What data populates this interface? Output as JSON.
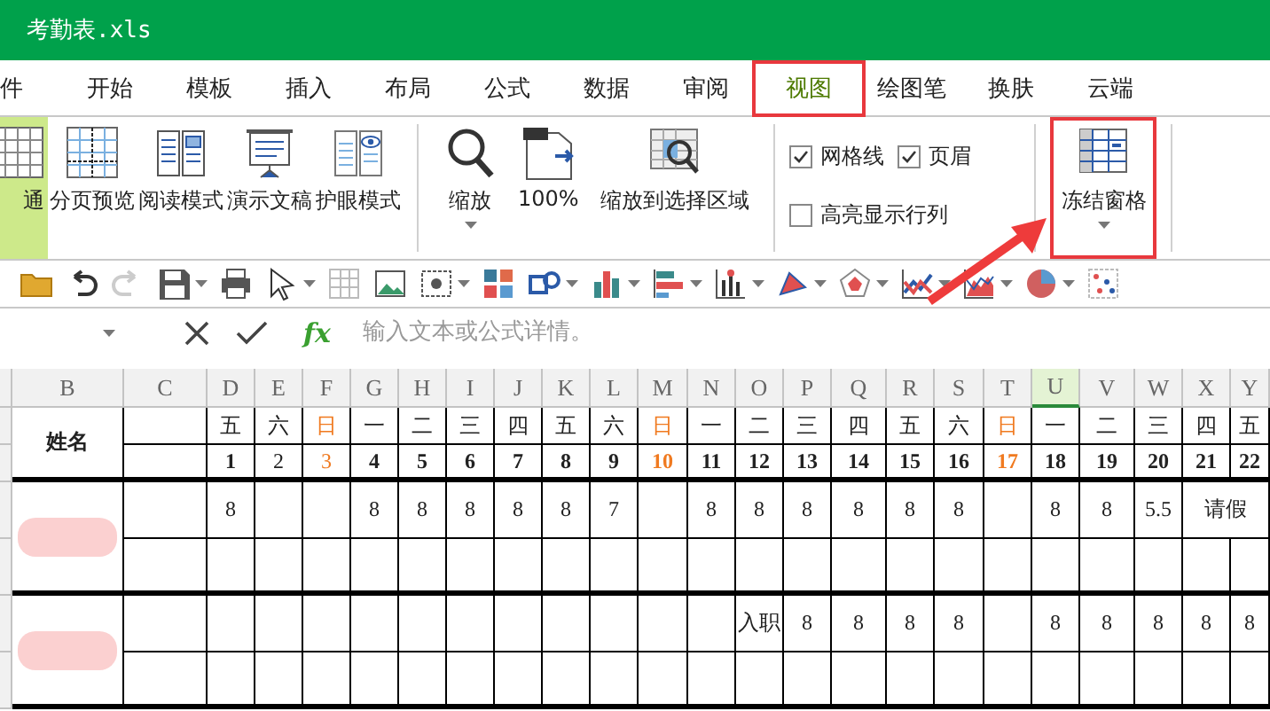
{
  "window": {
    "title": "考勤表.xls"
  },
  "menu_tabs": [
    {
      "label": "件",
      "selected": false,
      "highlighted": false
    },
    {
      "label": "开始",
      "selected": false,
      "highlighted": false
    },
    {
      "label": "模板",
      "selected": false,
      "highlighted": false
    },
    {
      "label": "插入",
      "selected": false,
      "highlighted": false
    },
    {
      "label": "布局",
      "selected": false,
      "highlighted": false
    },
    {
      "label": "公式",
      "selected": false,
      "highlighted": false
    },
    {
      "label": "数据",
      "selected": false,
      "highlighted": false
    },
    {
      "label": "审阅",
      "selected": false,
      "highlighted": false
    },
    {
      "label": "视图",
      "selected": true,
      "highlighted": true
    },
    {
      "label": "绘图笔",
      "selected": false,
      "highlighted": false
    },
    {
      "label": "换肤",
      "selected": false,
      "highlighted": false
    },
    {
      "label": "云端",
      "selected": false,
      "highlighted": false
    }
  ],
  "ribbon": {
    "view_buttons": [
      {
        "label": "通",
        "selected": true
      },
      {
        "label": "分页预览",
        "selected": false
      },
      {
        "label": "阅读模式",
        "selected": false
      },
      {
        "label": "演示文稿",
        "selected": false
      },
      {
        "label": "护眼模式",
        "selected": false
      }
    ],
    "zoom_buttons": [
      {
        "label": "缩放",
        "dropdown": true
      },
      {
        "label": "100%",
        "dropdown": false
      },
      {
        "label": "缩放到选择区域",
        "dropdown": false
      }
    ],
    "checkboxes": [
      {
        "label": "网格线",
        "checked": true
      },
      {
        "label": "页眉",
        "checked": true
      },
      {
        "label": "高亮显示行列",
        "checked": false
      }
    ],
    "freeze_button": {
      "label": "冻结窗格",
      "dropdown": true,
      "highlighted": true
    }
  },
  "formula_bar": {
    "placeholder": "输入文本或公式详情。",
    "fx": "fx"
  },
  "sheet": {
    "columns": [
      {
        "label": "B",
        "selected": false
      },
      {
        "label": "C",
        "selected": false
      },
      {
        "label": "D",
        "selected": false
      },
      {
        "label": "E",
        "selected": false
      },
      {
        "label": "F",
        "selected": false
      },
      {
        "label": "G",
        "selected": false
      },
      {
        "label": "H",
        "selected": false
      },
      {
        "label": "I",
        "selected": false
      },
      {
        "label": "J",
        "selected": false
      },
      {
        "label": "K",
        "selected": false
      },
      {
        "label": "L",
        "selected": false
      },
      {
        "label": "M",
        "selected": false
      },
      {
        "label": "N",
        "selected": false
      },
      {
        "label": "O",
        "selected": false
      },
      {
        "label": "P",
        "selected": false
      },
      {
        "label": "Q",
        "selected": false
      },
      {
        "label": "R",
        "selected": false
      },
      {
        "label": "S",
        "selected": false
      },
      {
        "label": "T",
        "selected": false
      },
      {
        "label": "U",
        "selected": true
      },
      {
        "label": "V",
        "selected": false
      },
      {
        "label": "W",
        "selected": false
      },
      {
        "label": "X",
        "selected": false
      },
      {
        "label": "Y",
        "selected": false
      }
    ],
    "name_header": "姓名",
    "weekdays": [
      {
        "text": "五",
        "weekend": false
      },
      {
        "text": "六",
        "weekend": false
      },
      {
        "text": "日",
        "weekend": true
      },
      {
        "text": "一",
        "weekend": false
      },
      {
        "text": "二",
        "weekend": false
      },
      {
        "text": "三",
        "weekend": false
      },
      {
        "text": "四",
        "weekend": false
      },
      {
        "text": "五",
        "weekend": false
      },
      {
        "text": "六",
        "weekend": false
      },
      {
        "text": "日",
        "weekend": true
      },
      {
        "text": "一",
        "weekend": false
      },
      {
        "text": "二",
        "weekend": false
      },
      {
        "text": "三",
        "weekend": false
      },
      {
        "text": "四",
        "weekend": false
      },
      {
        "text": "五",
        "weekend": false
      },
      {
        "text": "六",
        "weekend": false
      },
      {
        "text": "日",
        "weekend": true
      },
      {
        "text": "一",
        "weekend": false
      },
      {
        "text": "二",
        "weekend": false
      },
      {
        "text": "三",
        "weekend": false
      },
      {
        "text": "四",
        "weekend": false
      },
      {
        "text": "五",
        "weekend": false
      }
    ],
    "dates": [
      {
        "text": "1",
        "weekend": false,
        "bold": true
      },
      {
        "text": "2",
        "weekend": false,
        "bold": false
      },
      {
        "text": "3",
        "weekend": true,
        "bold": false
      },
      {
        "text": "4",
        "weekend": false,
        "bold": true
      },
      {
        "text": "5",
        "weekend": false,
        "bold": true
      },
      {
        "text": "6",
        "weekend": false,
        "bold": true
      },
      {
        "text": "7",
        "weekend": false,
        "bold": true
      },
      {
        "text": "8",
        "weekend": false,
        "bold": true
      },
      {
        "text": "9",
        "weekend": false,
        "bold": true
      },
      {
        "text": "10",
        "weekend": true,
        "bold": true
      },
      {
        "text": "11",
        "weekend": false,
        "bold": true
      },
      {
        "text": "12",
        "weekend": false,
        "bold": true
      },
      {
        "text": "13",
        "weekend": false,
        "bold": true
      },
      {
        "text": "14",
        "weekend": false,
        "bold": true
      },
      {
        "text": "15",
        "weekend": false,
        "bold": true
      },
      {
        "text": "16",
        "weekend": false,
        "bold": true
      },
      {
        "text": "17",
        "weekend": true,
        "bold": true
      },
      {
        "text": "18",
        "weekend": false,
        "bold": true
      },
      {
        "text": "19",
        "weekend": false,
        "bold": true
      },
      {
        "text": "20",
        "weekend": false,
        "bold": true
      },
      {
        "text": "21",
        "weekend": false,
        "bold": true
      },
      {
        "text": "22",
        "weekend": false,
        "bold": true
      }
    ],
    "employees": [
      {
        "hours": [
          {
            "kind": "value",
            "text": "8"
          },
          {
            "kind": "empty"
          },
          {
            "kind": "empty"
          },
          {
            "kind": "value",
            "text": "8"
          },
          {
            "kind": "value",
            "text": "8"
          },
          {
            "kind": "value",
            "text": "8"
          },
          {
            "kind": "value",
            "text": "8"
          },
          {
            "kind": "value",
            "text": "8"
          },
          {
            "kind": "value",
            "text": "7"
          },
          {
            "kind": "empty"
          },
          {
            "kind": "value",
            "text": "8"
          },
          {
            "kind": "value",
            "text": "8"
          },
          {
            "kind": "value",
            "text": "8"
          },
          {
            "kind": "value",
            "text": "8"
          },
          {
            "kind": "value",
            "text": "8"
          },
          {
            "kind": "value",
            "text": "8"
          },
          {
            "kind": "empty"
          },
          {
            "kind": "value",
            "text": "8"
          },
          {
            "kind": "value",
            "text": "8"
          },
          {
            "kind": "value",
            "text": "5.5"
          },
          {
            "kind": "merged",
            "text": "请假"
          }
        ]
      },
      {
        "hours": [
          {
            "kind": "empty"
          },
          {
            "kind": "empty"
          },
          {
            "kind": "empty"
          },
          {
            "kind": "empty"
          },
          {
            "kind": "empty"
          },
          {
            "kind": "empty"
          },
          {
            "kind": "empty"
          },
          {
            "kind": "empty"
          },
          {
            "kind": "empty"
          },
          {
            "kind": "empty"
          },
          {
            "kind": "empty"
          },
          {
            "kind": "value",
            "text": "入职"
          },
          {
            "kind": "value",
            "text": "8"
          },
          {
            "kind": "value",
            "text": "8"
          },
          {
            "kind": "value",
            "text": "8"
          },
          {
            "kind": "value",
            "text": "8"
          },
          {
            "kind": "empty"
          },
          {
            "kind": "value",
            "text": "8"
          },
          {
            "kind": "value",
            "text": "8"
          },
          {
            "kind": "value",
            "text": "8"
          },
          {
            "kind": "value",
            "text": "8"
          },
          {
            "kind": "value",
            "text": "8"
          }
        ]
      }
    ]
  }
}
